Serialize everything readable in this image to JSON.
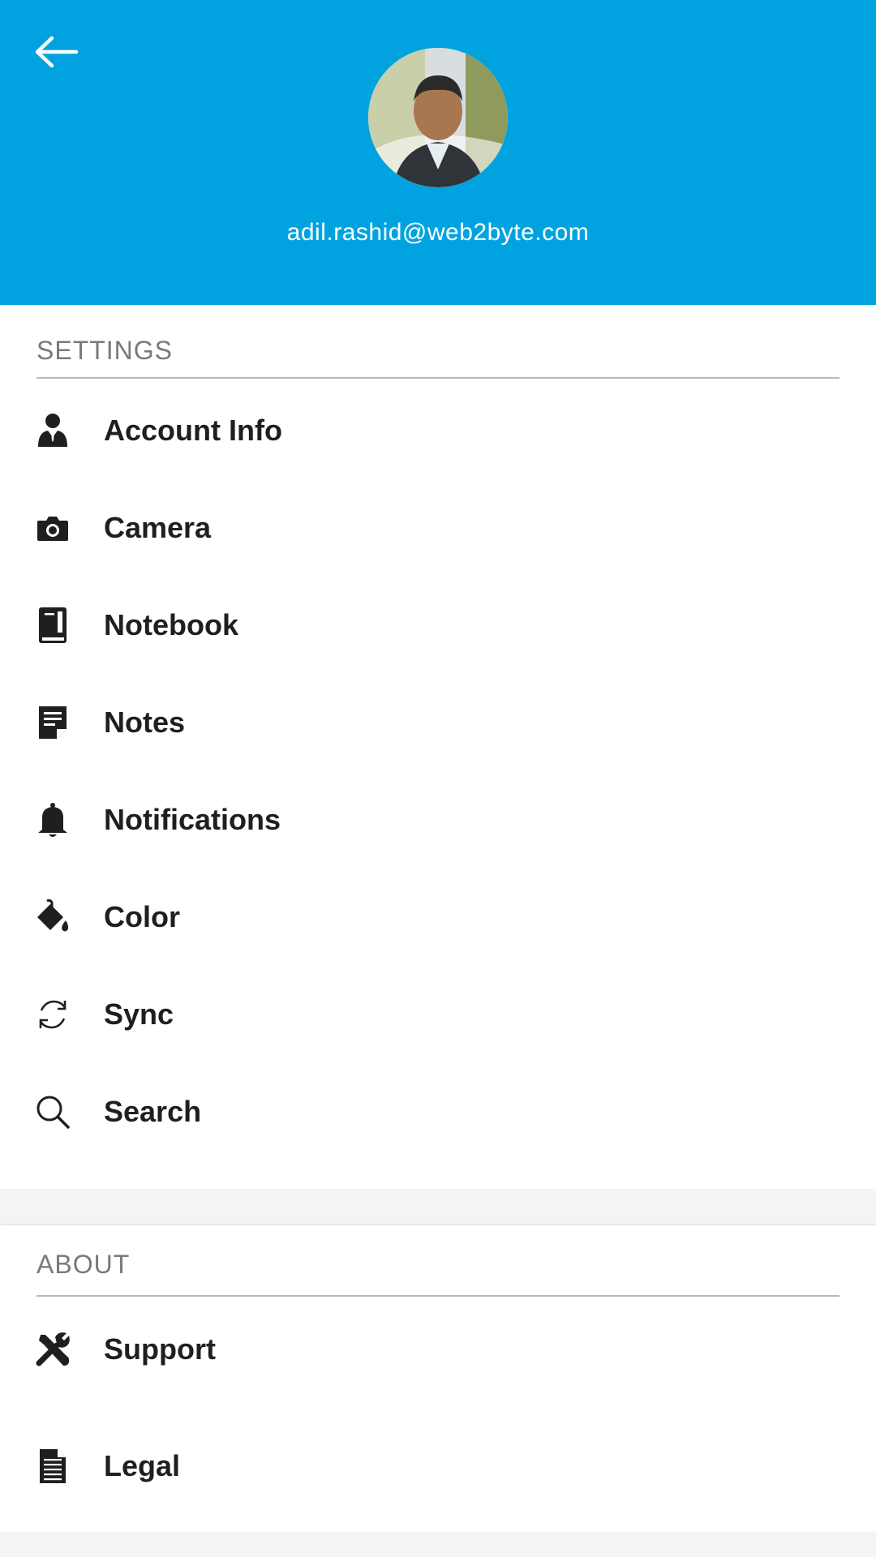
{
  "header": {
    "back_icon": "arrow-left-icon",
    "email": "adil.rashid@web2byte.com",
    "accent_color": "#00a3e0"
  },
  "settings": {
    "title": "SETTINGS",
    "items": [
      {
        "label": "Account Info",
        "icon": "user-tie-icon"
      },
      {
        "label": "Camera",
        "icon": "camera-icon"
      },
      {
        "label": "Notebook",
        "icon": "book-icon"
      },
      {
        "label": "Notes",
        "icon": "note-icon"
      },
      {
        "label": "Notifications",
        "icon": "bell-icon"
      },
      {
        "label": "Color",
        "icon": "paint-bucket-icon"
      },
      {
        "label": "Sync",
        "icon": "sync-icon"
      },
      {
        "label": "Search",
        "icon": "search-icon"
      }
    ]
  },
  "about": {
    "title": "ABOUT",
    "items": [
      {
        "label": "Support",
        "icon": "tools-icon"
      },
      {
        "label": "Legal",
        "icon": "document-icon"
      }
    ]
  }
}
